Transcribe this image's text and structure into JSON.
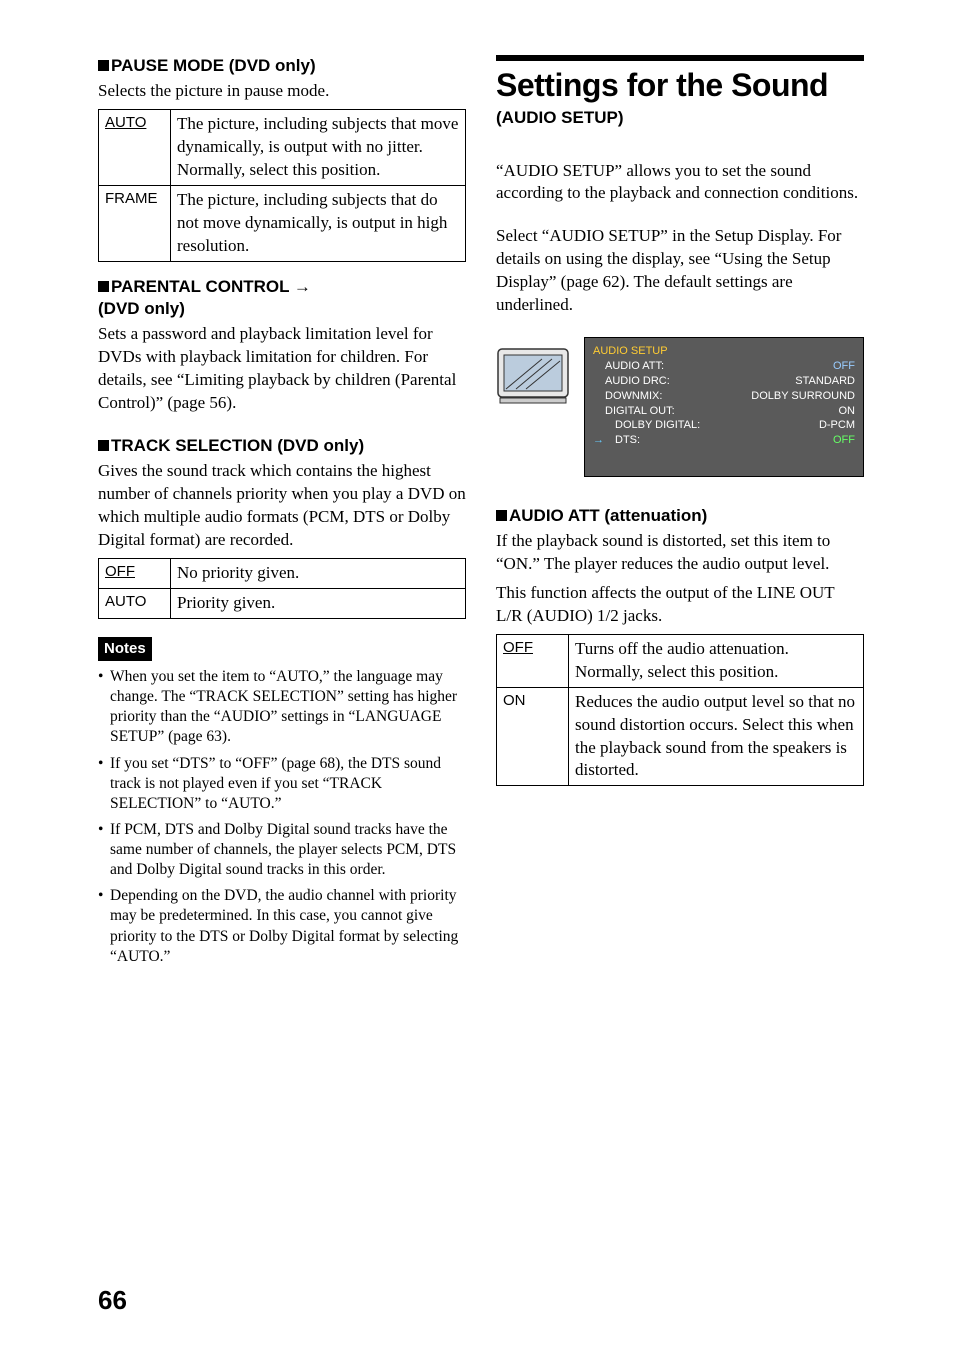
{
  "left": {
    "pause_heading": "PAUSE MODE (DVD only)",
    "pause_intro": "Selects the picture in pause mode.",
    "pause_table": [
      {
        "key": "AUTO",
        "underline": true,
        "val": "The picture, including subjects that move dynamically, is output with no jitter. Normally, select this position."
      },
      {
        "key": "FRAME",
        "underline": false,
        "val": "The picture, including subjects that do not move dynamically, is output in high resolution."
      }
    ],
    "parental_heading_line1": "PARENTAL CONTROL ",
    "parental_heading_line2": "(DVD only)",
    "parental_text": "Sets a password and playback limitation level for DVDs with playback limitation for children. For details, see “Limiting playback by children (Parental Control)” (page 56).",
    "track_heading": "TRACK SELECTION (DVD only)",
    "track_text": "Gives the sound track which contains the highest number of channels priority when you play a DVD on which multiple audio formats (PCM, DTS or Dolby Digital format) are recorded.",
    "track_table": [
      {
        "key": "OFF",
        "underline": true,
        "val": "No priority given."
      },
      {
        "key": "AUTO",
        "underline": false,
        "val": "Priority given."
      }
    ],
    "notes_label": "Notes",
    "notes": [
      "When you set the item to “AUTO,” the language may change. The “TRACK SELECTION” setting has higher priority than the “AUDIO” settings in “LANGUAGE SETUP” (page 63).",
      "If you set “DTS” to “OFF” (page 68), the DTS sound track is not played even if you set “TRACK SELECTION” to “AUTO.”",
      "If PCM, DTS and Dolby Digital sound tracks have the same number of channels, the player selects PCM, DTS and Dolby Digital sound tracks in this order.",
      "Depending on the DVD, the audio channel with priority may be predetermined. In this case, you cannot give priority to the DTS or Dolby Digital format by selecting “AUTO.”"
    ]
  },
  "right": {
    "main_title": "Settings for the Sound",
    "sub_title": "(AUDIO SETUP)",
    "intro1": "“AUDIO SETUP” allows you to set the sound according to the playback and connection conditions.",
    "intro2": "Select “AUDIO SETUP” in the Setup Display. For details on using the display, see “Using the Setup Display” (page 62). The default settings are underlined.",
    "osd": {
      "title": "AUDIO SETUP",
      "rows": [
        {
          "label": "AUDIO ATT:",
          "value": "OFF",
          "sub": false
        },
        {
          "label": "AUDIO DRC:",
          "value": "STANDARD",
          "sub": false
        },
        {
          "label": "DOWNMIX:",
          "value": "DOLBY SURROUND",
          "sub": false
        },
        {
          "label": "DIGITAL OUT:",
          "value": "ON",
          "sub": false
        },
        {
          "label": "DOLBY DIGITAL:",
          "value": "D-PCM",
          "sub": true
        },
        {
          "label": "DTS:",
          "value": "OFF",
          "sub": true
        }
      ]
    },
    "att_heading": "AUDIO ATT (attenuation)",
    "att_text1": "If the playback sound is distorted, set this item to “ON.”  The player reduces the audio output level.",
    "att_text2": "This function affects the output of the LINE OUT L/R (AUDIO) 1/2  jacks.",
    "att_table": [
      {
        "key": "OFF",
        "underline": true,
        "val": "Turns off the audio attenuation. Normally, select this position."
      },
      {
        "key": "ON",
        "underline": false,
        "val": "Reduces the audio output level so that no sound distortion occurs. Select this when the playback sound from the speakers is distorted."
      }
    ]
  },
  "page_number": "66"
}
